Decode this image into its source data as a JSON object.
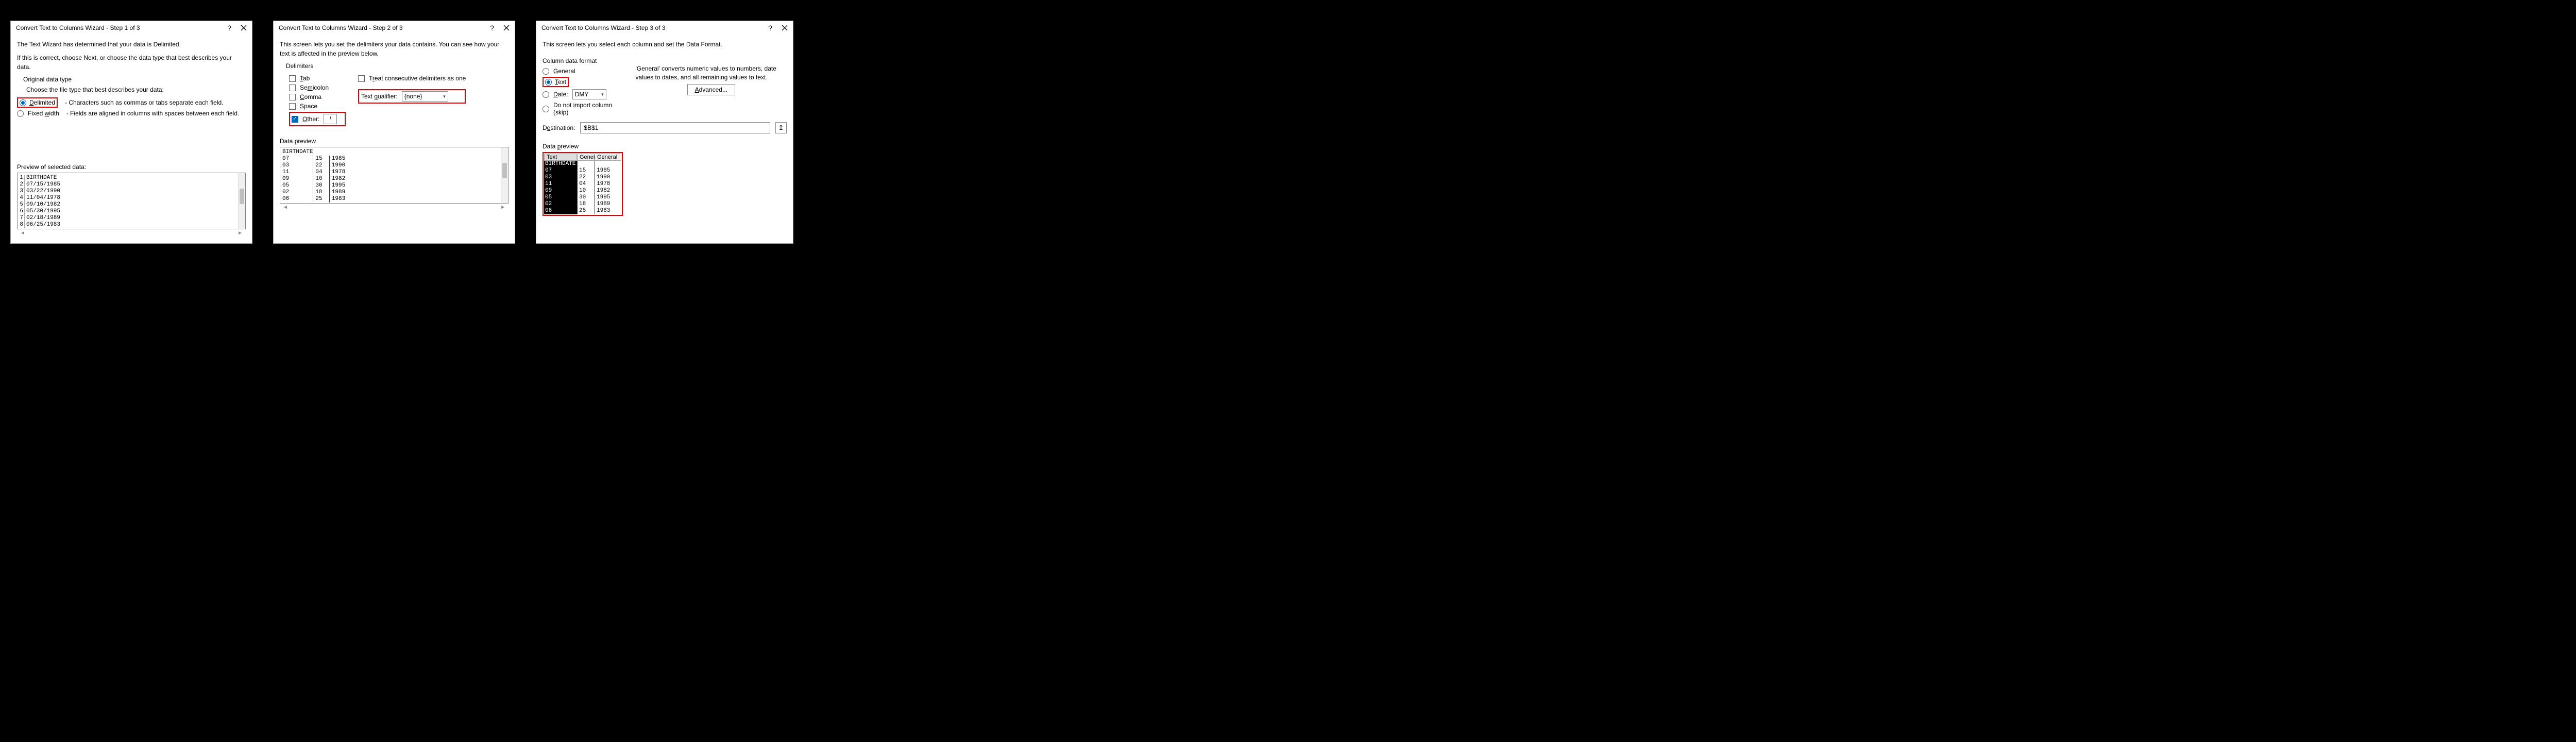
{
  "step1": {
    "title": "Convert Text to Columns Wizard - Step 1 of 3",
    "intro1": "The Text Wizard has determined that your data is Delimited.",
    "intro2": "If this is correct, choose Next, or choose the data type that best describes your data.",
    "group": "Original data type",
    "choose": "Choose the file type that best describes your data:",
    "delimited_label": "Delimited",
    "delimited_desc": "- Characters such as commas or tabs separate each field.",
    "fixed_label": "Fixed width",
    "fixed_desc": "- Fields are aligned in columns with spaces between each field.",
    "preview_label": "Preview of selected data:",
    "rows": [
      {
        "n": "1",
        "v": "BIRTHDATE"
      },
      {
        "n": "2",
        "v": "07/15/1985"
      },
      {
        "n": "3",
        "v": "03/22/1990"
      },
      {
        "n": "4",
        "v": "11/04/1978"
      },
      {
        "n": "5",
        "v": "09/10/1982"
      },
      {
        "n": "6",
        "v": "05/30/1995"
      },
      {
        "n": "7",
        "v": "02/18/1989"
      },
      {
        "n": "8",
        "v": "06/25/1983"
      }
    ]
  },
  "step2": {
    "title": "Convert Text to Columns Wizard - Step 2 of 3",
    "intro": "This screen lets you set the delimiters your data contains.  You can see how your text is affected in the preview below.",
    "group": "Delimiters",
    "tab": "Tab",
    "semicolon": "Semicolon",
    "comma": "Comma",
    "space": "Space",
    "other": "Other:",
    "other_val": "/",
    "treat": "Treat consecutive delimiters as one",
    "qual_label": "Text qualifier:",
    "qual_val": "{none}",
    "preview_label": "Data preview",
    "rows": [
      {
        "a": "BIRTHDATE",
        "b": "",
        "c": ""
      },
      {
        "a": "07",
        "b": "15",
        "c": "1985"
      },
      {
        "a": "03",
        "b": "22",
        "c": "1990"
      },
      {
        "a": "11",
        "b": "04",
        "c": "1978"
      },
      {
        "a": "09",
        "b": "10",
        "c": "1982"
      },
      {
        "a": "05",
        "b": "30",
        "c": "1995"
      },
      {
        "a": "02",
        "b": "18",
        "c": "1989"
      },
      {
        "a": "06",
        "b": "25",
        "c": "1983"
      }
    ]
  },
  "step3": {
    "title": "Convert Text to Columns Wizard - Step 3 of 3",
    "intro": "This screen lets you select each column and set the Data Format.",
    "group": "Column data format",
    "general": "General",
    "text": "Text",
    "date": "Date:",
    "date_fmt": "DMY",
    "skip": "Do not import column (skip)",
    "note": "'General' converts numeric values to numbers, date values to dates, and all remaining values to text.",
    "advanced": "Advanced...",
    "dest_label": "Destination:",
    "dest_val": "$B$1",
    "preview_label": "Data preview",
    "headers": {
      "h1": "Text",
      "h2": "Gener",
      "h3": "General"
    },
    "rows": [
      {
        "a": "BIRTHDATE",
        "b": "",
        "c": ""
      },
      {
        "a": "07",
        "b": "15",
        "c": "1985"
      },
      {
        "a": "03",
        "b": "22",
        "c": "1990"
      },
      {
        "a": "11",
        "b": "04",
        "c": "1978"
      },
      {
        "a": "09",
        "b": "10",
        "c": "1982"
      },
      {
        "a": "05",
        "b": "30",
        "c": "1995"
      },
      {
        "a": "02",
        "b": "18",
        "c": "1989"
      },
      {
        "a": "06",
        "b": "25",
        "c": "1983"
      }
    ]
  }
}
